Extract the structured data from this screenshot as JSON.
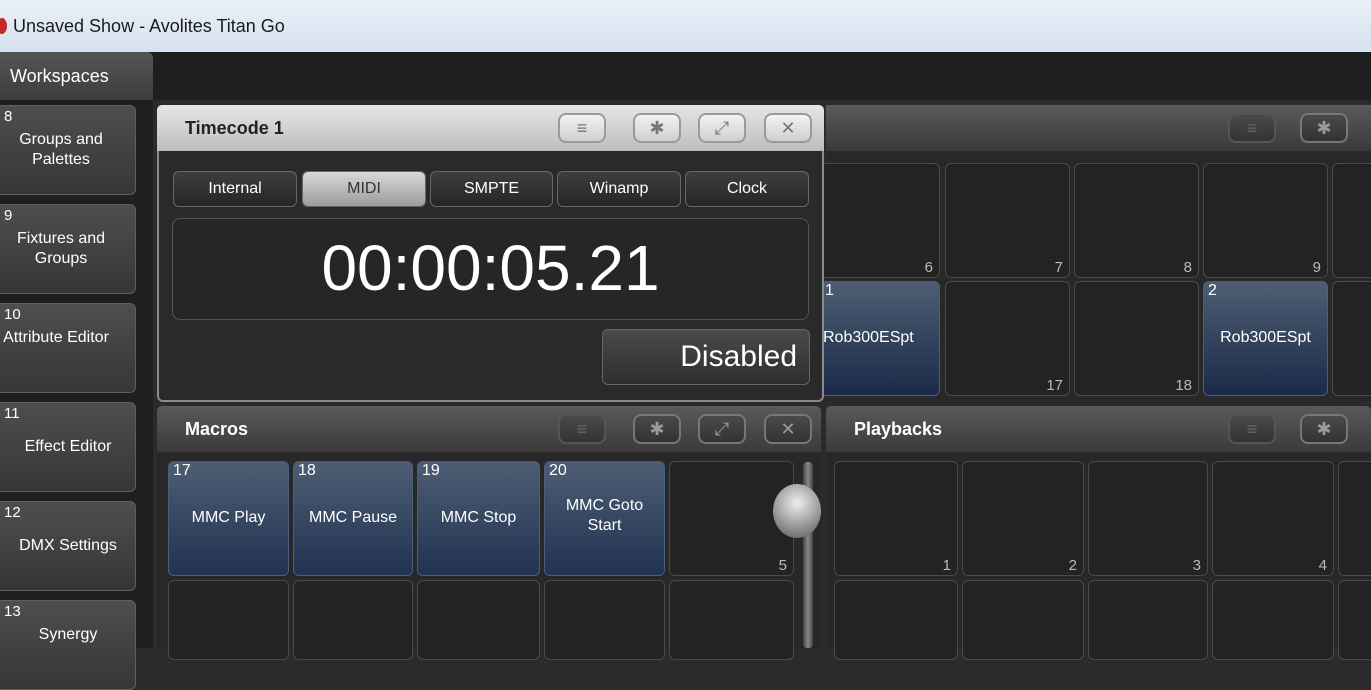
{
  "window": {
    "title": "Unsaved Show - Avolites Titan Go"
  },
  "sidebar": {
    "header": "Workspaces",
    "items": [
      {
        "num": "8",
        "label": "Groups and Palettes"
      },
      {
        "num": "9",
        "label": "Fixtures and Groups"
      },
      {
        "num": "10",
        "label": "Attribute Editor"
      },
      {
        "num": "11",
        "label": "Effect Editor"
      },
      {
        "num": "12",
        "label": "DMX Settings"
      },
      {
        "num": "13",
        "label": "Synergy"
      }
    ]
  },
  "timecode": {
    "title": "Timecode 1",
    "tabs": [
      "Internal",
      "MIDI",
      "SMPTE",
      "Winamp",
      "Clock"
    ],
    "active_tab": "MIDI",
    "time": "00:00:05.21",
    "status_button": "Disabled"
  },
  "fixtures_grid": {
    "cells": [
      {
        "num": "6"
      },
      {
        "num": "7"
      },
      {
        "num": "8"
      },
      {
        "num": "9"
      },
      {
        "id": "1",
        "label": "Rob300ESpt"
      },
      {
        "num": "17"
      },
      {
        "num": "18"
      },
      {
        "id": "2",
        "label": "Rob300ESpt"
      }
    ]
  },
  "macros": {
    "title": "Macros",
    "items": [
      {
        "num": "17",
        "label": "MMC Play"
      },
      {
        "num": "18",
        "label": "MMC Pause"
      },
      {
        "num": "19",
        "label": "MMC Stop"
      },
      {
        "num": "20",
        "label": "MMC Goto Start"
      }
    ],
    "empty_num": "5"
  },
  "playbacks": {
    "title": "Playbacks",
    "nums": [
      "1",
      "2",
      "3",
      "4"
    ]
  },
  "header_icons": {
    "menu": "≡",
    "settings": "✱",
    "maximize": "⤢",
    "close": "✕"
  }
}
